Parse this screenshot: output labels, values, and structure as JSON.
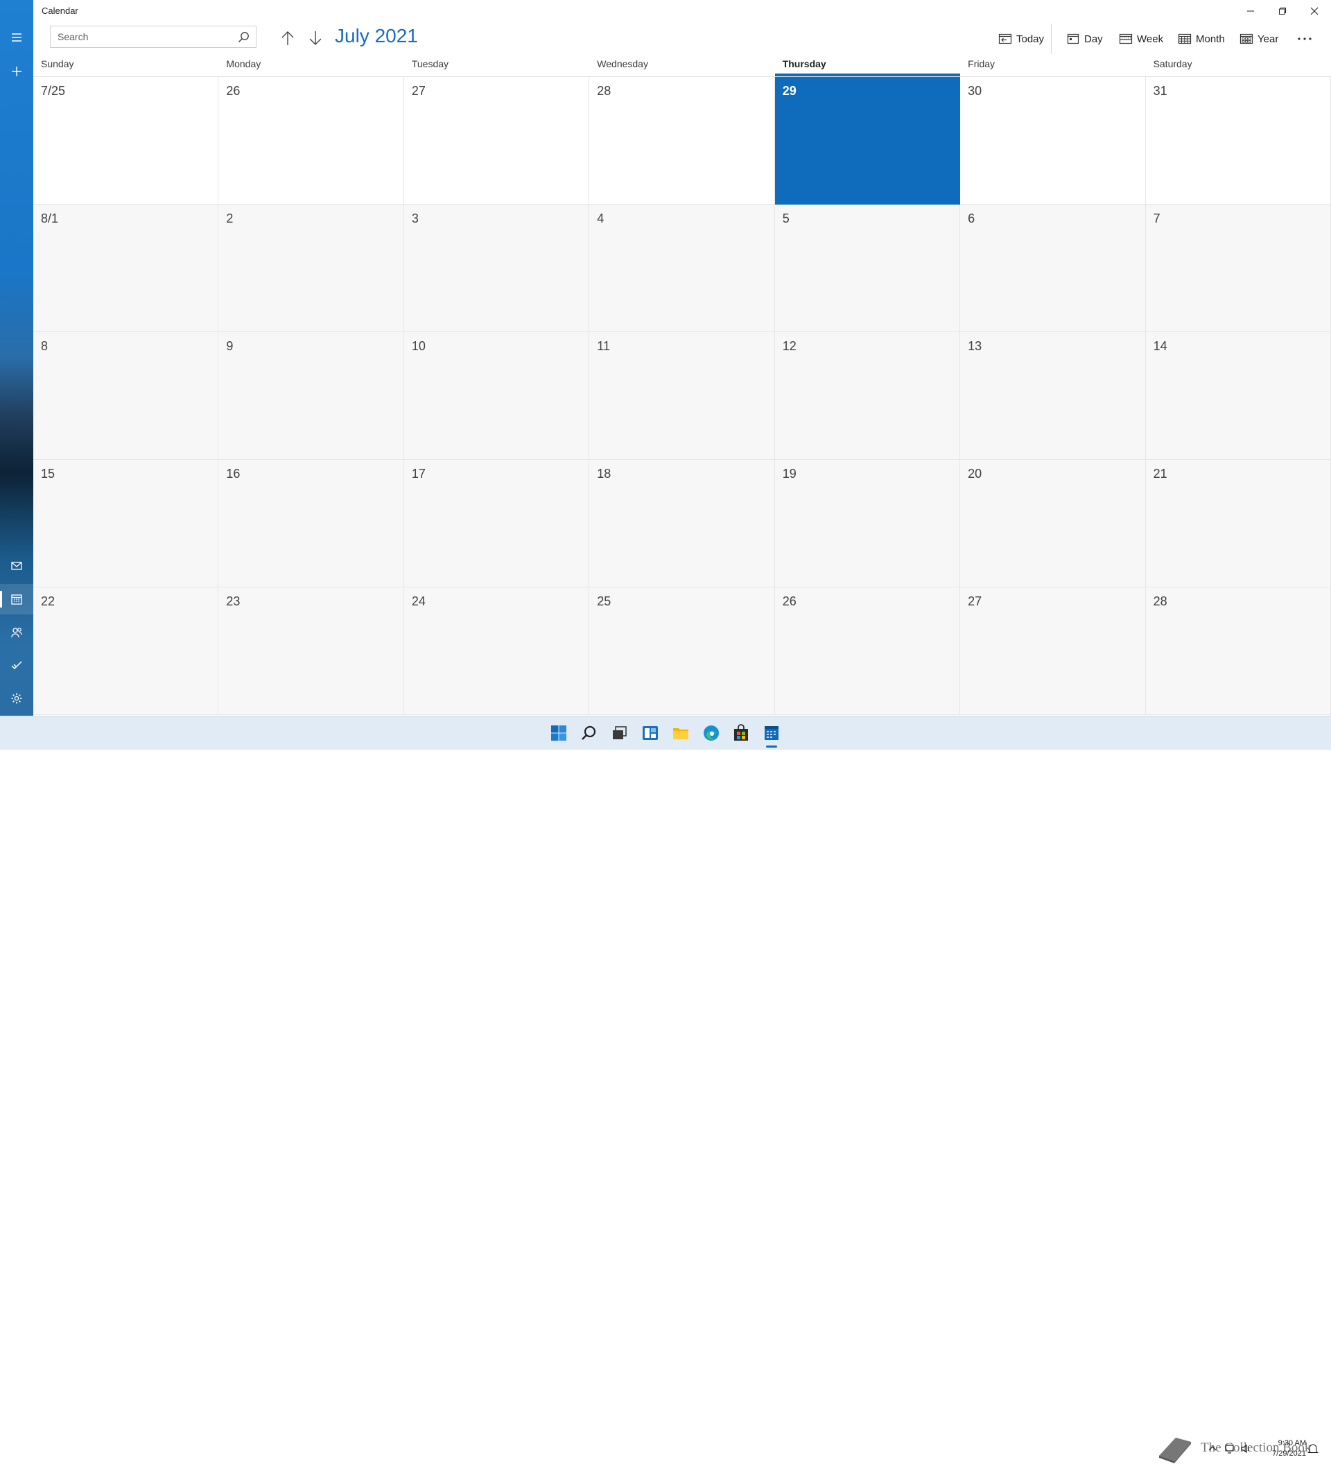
{
  "window": {
    "title": "Calendar"
  },
  "toolbar": {
    "search_placeholder": "Search",
    "month_title": "July 2021",
    "views": [
      {
        "label": "Today",
        "icon": "today-icon"
      },
      {
        "label": "Day",
        "icon": "day-view-icon"
      },
      {
        "label": "Week",
        "icon": "week-view-icon"
      },
      {
        "label": "Month",
        "icon": "month-view-icon"
      },
      {
        "label": "Year",
        "icon": "year-view-icon"
      }
    ],
    "more_label": "···"
  },
  "calendar": {
    "weekdays": [
      "Sunday",
      "Monday",
      "Tuesday",
      "Wednesday",
      "Thursday",
      "Friday",
      "Saturday"
    ],
    "today_column": 4,
    "weeks": [
      [
        {
          "label": "7/25",
          "kind": "cur"
        },
        {
          "label": "26",
          "kind": "cur"
        },
        {
          "label": "27",
          "kind": "cur"
        },
        {
          "label": "28",
          "kind": "cur"
        },
        {
          "label": "29",
          "kind": "today"
        },
        {
          "label": "30",
          "kind": "cur"
        },
        {
          "label": "31",
          "kind": "cur"
        }
      ],
      [
        {
          "label": "8/1",
          "kind": "other"
        },
        {
          "label": "2",
          "kind": "other"
        },
        {
          "label": "3",
          "kind": "other"
        },
        {
          "label": "4",
          "kind": "other"
        },
        {
          "label": "5",
          "kind": "other"
        },
        {
          "label": "6",
          "kind": "other"
        },
        {
          "label": "7",
          "kind": "other"
        }
      ],
      [
        {
          "label": "8",
          "kind": "other"
        },
        {
          "label": "9",
          "kind": "other"
        },
        {
          "label": "10",
          "kind": "other"
        },
        {
          "label": "11",
          "kind": "other"
        },
        {
          "label": "12",
          "kind": "other"
        },
        {
          "label": "13",
          "kind": "other"
        },
        {
          "label": "14",
          "kind": "other"
        }
      ],
      [
        {
          "label": "15",
          "kind": "other"
        },
        {
          "label": "16",
          "kind": "other"
        },
        {
          "label": "17",
          "kind": "other"
        },
        {
          "label": "18",
          "kind": "other"
        },
        {
          "label": "19",
          "kind": "other"
        },
        {
          "label": "20",
          "kind": "other"
        },
        {
          "label": "21",
          "kind": "other"
        }
      ],
      [
        {
          "label": "22",
          "kind": "other"
        },
        {
          "label": "23",
          "kind": "other"
        },
        {
          "label": "24",
          "kind": "other"
        },
        {
          "label": "25",
          "kind": "other"
        },
        {
          "label": "26",
          "kind": "other"
        },
        {
          "label": "27",
          "kind": "other"
        },
        {
          "label": "28",
          "kind": "other"
        }
      ]
    ]
  },
  "sidebar": {
    "top": [
      "hamburger-menu-icon",
      "new-event-icon"
    ],
    "bottom": [
      "mail-icon",
      "calendar-icon",
      "people-icon",
      "todo-icon",
      "settings-icon"
    ],
    "active": "calendar-icon"
  },
  "taskbar": {
    "apps": [
      "start-icon",
      "search-icon",
      "task-view-icon",
      "widgets-icon",
      "file-explorer-icon",
      "edge-icon",
      "store-icon",
      "calendar-app-icon"
    ],
    "active": "calendar-app-icon",
    "clock_time": "9:30 AM",
    "clock_date": "7/29/2021",
    "watermark": "The Collection Book"
  },
  "colors": {
    "accent": "#0f6cbd",
    "month_title": "#1a6cbf",
    "other_month_cell": "#f7f7f7"
  }
}
